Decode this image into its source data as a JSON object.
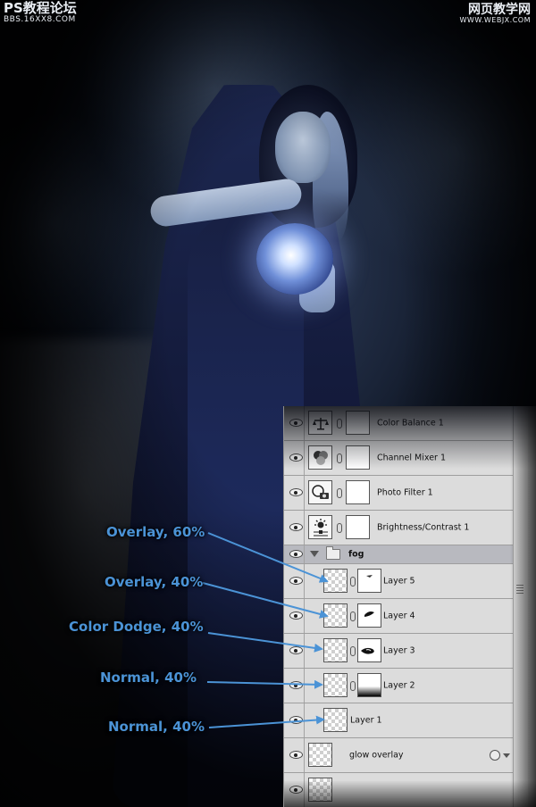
{
  "watermark_left": {
    "line1": "PS教程论坛",
    "line2": "BBS.16XX8.COM"
  },
  "watermark_right": {
    "line1": "网页教学网",
    "line2": "WWW.WEBJX.COM"
  },
  "colors": {
    "callout": "#4b93d6",
    "panel_bg": "#dcdcdc",
    "group_row": "#b8b9bf"
  },
  "layers": [
    {
      "name": "Color Balance 1",
      "type": "adjustment",
      "icon": "balance-scale-icon",
      "fx": false
    },
    {
      "name": "Channel Mixer 1",
      "type": "adjustment",
      "icon": "channel-mixer-icon",
      "fx": false
    },
    {
      "name": "Photo Filter 1",
      "type": "adjustment",
      "icon": "photo-filter-icon",
      "fx": false
    },
    {
      "name": "Brightness/Contrast 1",
      "type": "adjustment",
      "icon": "brightness-contrast-icon",
      "fx": false
    },
    {
      "name": "fog",
      "type": "group",
      "icon": "folder-icon",
      "fx": false
    },
    {
      "name": "Layer 5",
      "type": "pixel-masked",
      "icon": "layer-thumbnail",
      "fx": false
    },
    {
      "name": "Layer 4",
      "type": "pixel-masked",
      "icon": "layer-thumbnail",
      "fx": false
    },
    {
      "name": "Layer 3",
      "type": "pixel-masked",
      "icon": "layer-thumbnail",
      "fx": false
    },
    {
      "name": "Layer 2",
      "type": "pixel-masked",
      "icon": "layer-thumbnail",
      "fx": false
    },
    {
      "name": "Layer 1",
      "type": "pixel",
      "icon": "layer-thumbnail",
      "fx": false
    },
    {
      "name": "glow overlay",
      "type": "smart",
      "icon": "layer-thumbnail",
      "fx": true
    }
  ],
  "callouts": [
    {
      "text": "Overlay, 60%",
      "target": "Layer 5"
    },
    {
      "text": "Overlay, 40%",
      "target": "Layer 4"
    },
    {
      "text": "Color Dodge, 40%",
      "target": "Layer 3"
    },
    {
      "text": "Normal, 40%",
      "target": "Layer 2"
    },
    {
      "text": "Normal, 40%",
      "target": "Layer 1"
    }
  ]
}
